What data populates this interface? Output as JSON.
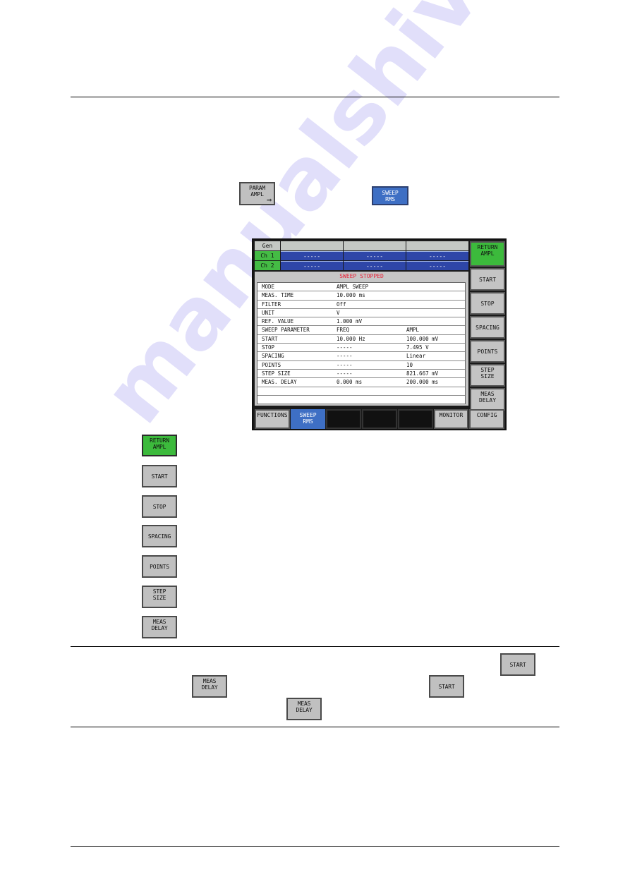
{
  "intro_buttons": {
    "param_ampl": {
      "line1": "PARAM",
      "line2": "AMPL",
      "arrow": "⇒"
    },
    "sweep_rms": {
      "line1": "SWEEP",
      "line2": "RMS"
    }
  },
  "screen": {
    "gen_header": {
      "label": "Gen",
      "cells": [
        "",
        "",
        ""
      ]
    },
    "channels": [
      {
        "label": "Ch 1",
        "cells": [
          "-----",
          "-----",
          "-----"
        ]
      },
      {
        "label": "Ch 2",
        "cells": [
          "-----",
          "-----",
          "-----"
        ]
      }
    ],
    "status": "SWEEP STOPPED",
    "status_color": "#e8243a",
    "rows": [
      {
        "name": "MODE",
        "v1": "AMPL SWEEP",
        "v2": ""
      },
      {
        "name": "MEAS. TIME",
        "v1": "10.000 ms",
        "v2": ""
      },
      {
        "name": "FILTER",
        "v1": "Off",
        "v2": ""
      },
      {
        "name": "UNIT",
        "v1": "V",
        "v2": ""
      },
      {
        "name": "REF. VALUE",
        "v1": "1.000 mV",
        "v2": ""
      },
      {
        "name": "SWEEP PARAMETER",
        "v1": "FREQ",
        "v2": "AMPL"
      },
      {
        "name": "START",
        "v1": "10.000 Hz",
        "v2": "100.000 mV"
      },
      {
        "name": "STOP",
        "v1": "-----",
        "v2": "7.495 V"
      },
      {
        "name": "SPACING",
        "v1": "-----",
        "v2": "Linear"
      },
      {
        "name": "POINTS",
        "v1": "-----",
        "v2": "10"
      },
      {
        "name": "STEP SIZE",
        "v1": "-----",
        "v2": "821.667 mV"
      },
      {
        "name": "MEAS. DELAY",
        "v1": "0.000 ms",
        "v2": "200.000 ms"
      },
      {
        "name": "",
        "v1": "",
        "v2": ""
      },
      {
        "name": "",
        "v1": "",
        "v2": ""
      }
    ],
    "side_softkeys": [
      {
        "line1": "RETURN",
        "line2": "AMPL"
      },
      {
        "line1": "START",
        "line2": ""
      },
      {
        "line1": "STOP",
        "line2": ""
      },
      {
        "line1": "SPACING",
        "line2": ""
      },
      {
        "line1": "POINTS",
        "line2": ""
      },
      {
        "line1": "STEP",
        "line2": "SIZE"
      },
      {
        "line1": "MEAS",
        "line2": "DELAY"
      }
    ],
    "bottom_softkeys": [
      {
        "line1": "FUNCTIONS",
        "line2": ""
      },
      {
        "line1": "SWEEP",
        "line2": "RMS"
      },
      {
        "line1": "",
        "line2": ""
      },
      {
        "line1": "",
        "line2": ""
      },
      {
        "line1": "",
        "line2": ""
      },
      {
        "line1": "MONITOR",
        "line2": ""
      },
      {
        "line1": "CONFIG",
        "line2": ""
      }
    ]
  },
  "legend_buttons": [
    {
      "line1": "RETURN",
      "line2": "AMPL"
    },
    {
      "line1": "START",
      "line2": ""
    },
    {
      "line1": "STOP",
      "line2": ""
    },
    {
      "line1": "SPACING",
      "line2": ""
    },
    {
      "line1": "POINTS",
      "line2": ""
    },
    {
      "line1": "STEP",
      "line2": "SIZE"
    },
    {
      "line1": "MEAS",
      "line2": "DELAY"
    }
  ],
  "note_buttons": {
    "start_a": {
      "line1": "START"
    },
    "meas_delay_a": {
      "line1": "MEAS",
      "line2": "DELAY"
    },
    "start_b": {
      "line1": "START"
    },
    "meas_delay_b": {
      "line1": "MEAS",
      "line2": "DELAY"
    }
  },
  "watermark": "manualshive.com",
  "colors": {
    "green": "#3cba3c",
    "blue": "#3e6fc4",
    "gray": "#c0c0c0",
    "channel_blue": "#2e46a8"
  }
}
